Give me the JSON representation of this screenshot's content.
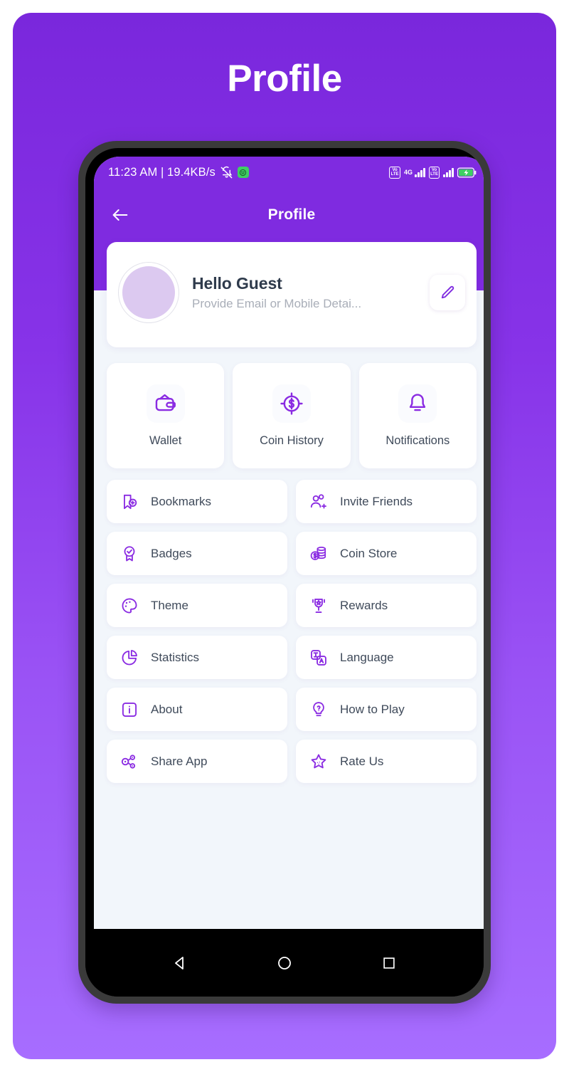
{
  "promo": {
    "title": "Profile",
    "background_gradient_top": "#7A27DC",
    "background_gradient_bottom": "#A76DFF"
  },
  "status_bar": {
    "clock_and_speed": "11:23 AM | 19.4KB/s",
    "mute_icon": "bell-muted-icon",
    "app_badge_icon": "green-app-badge-icon",
    "sim1_volte": "Vo LTE",
    "network_type": "4G",
    "sim2_volte": "Vo LTE",
    "battery_icon": "battery-charging-icon",
    "battery_color": "#3ED063"
  },
  "app_bar": {
    "back_icon": "arrow-left-icon",
    "title": "Profile",
    "background": "#7F2BE0"
  },
  "profile_card": {
    "avatar_icon": "avatar-placeholder",
    "avatar_color": "#DCC9F0",
    "name": "Hello Guest",
    "subtitle": "Provide Email or Mobile Detai...",
    "edit_icon": "pencil-icon"
  },
  "quick_actions": [
    {
      "label": "Wallet",
      "icon": "wallet-icon"
    },
    {
      "label": "Coin History",
      "icon": "coin-target-icon"
    },
    {
      "label": "Notifications",
      "icon": "bell-icon"
    }
  ],
  "menu_items": [
    {
      "label": "Bookmarks",
      "icon": "bookmark-add-icon"
    },
    {
      "label": "Invite Friends",
      "icon": "user-add-icon"
    },
    {
      "label": "Badges",
      "icon": "award-check-icon"
    },
    {
      "label": "Coin Store",
      "icon": "coin-stack-icon"
    },
    {
      "label": "Theme",
      "icon": "palette-icon"
    },
    {
      "label": "Rewards",
      "icon": "trophy-star-icon"
    },
    {
      "label": "Statistics",
      "icon": "pie-chart-icon"
    },
    {
      "label": "Language",
      "icon": "translate-icon"
    },
    {
      "label": "About",
      "icon": "info-box-icon"
    },
    {
      "label": "How to Play",
      "icon": "lightbulb-question-icon"
    },
    {
      "label": "Share App",
      "icon": "share-nodes-icon"
    },
    {
      "label": "Rate Us",
      "icon": "star-icon"
    }
  ],
  "nav_bar": {
    "back": "triangle-back-icon",
    "home": "circle-home-icon",
    "recents": "square-recents-icon"
  },
  "colors": {
    "accent_purple": "#7F2BE0",
    "icon_purple": "#8A2BE2",
    "page_background": "#F2F6FB",
    "text_dark": "#3F4A5A",
    "text_muted": "#A9AEB8"
  }
}
